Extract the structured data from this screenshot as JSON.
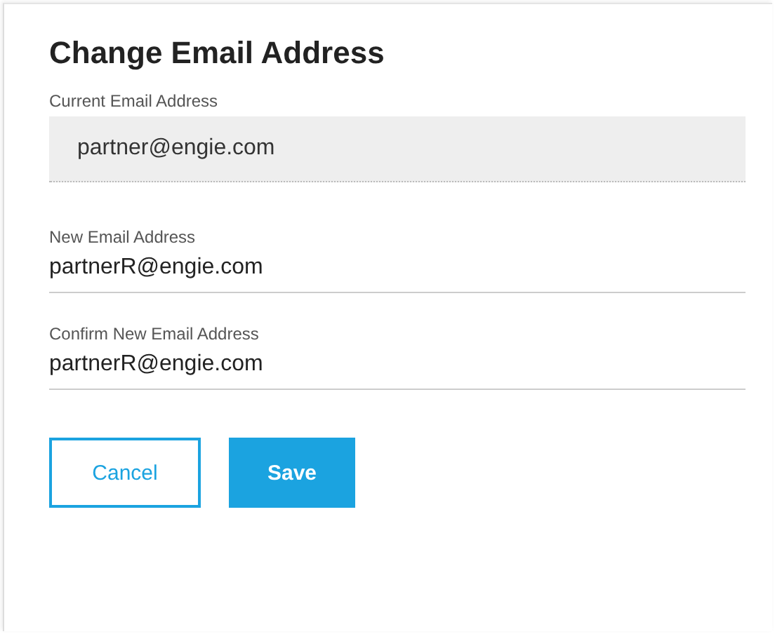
{
  "title": "Change Email Address",
  "fields": [
    {
      "label": "Current Email Address",
      "value": "partner@engie.com",
      "disabled": true
    },
    {
      "label": "New Email Address",
      "value": "partnerR@engie.com",
      "disabled": false
    },
    {
      "label": "Confirm New Email Address",
      "value": "partnerR@engie.com",
      "disabled": false
    }
  ],
  "buttons": [
    {
      "label": "Cancel",
      "kind": "secondary"
    },
    {
      "label": "Save",
      "kind": "primary"
    }
  ]
}
